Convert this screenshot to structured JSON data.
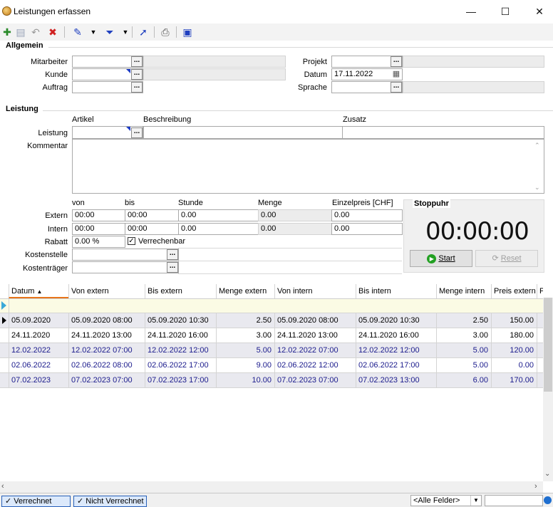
{
  "window": {
    "title": "Leistungen erfassen",
    "minimize": "—",
    "maximize": "☐",
    "close": "✕"
  },
  "toolbar": {
    "items": [
      "new-icon",
      "save-icon",
      "undo-icon",
      "delete-icon",
      "pin-icon",
      "filter-icon",
      "pointer-icon",
      "print-icon",
      "calculator-icon"
    ],
    "accent": "#1f3fbf"
  },
  "allgemein": {
    "title": "Allgemein",
    "mitarbeiter_label": "Mitarbeiter",
    "mitarbeiter_value": "",
    "kunde_label": "Kunde",
    "kunde_value": "",
    "auftrag_label": "Auftrag",
    "auftrag_value": "",
    "projekt_label": "Projekt",
    "projekt_value": "",
    "datum_label": "Datum",
    "datum_value": "17.11.2022",
    "sprache_label": "Sprache",
    "sprache_value": "",
    "dots": "..."
  },
  "leistung": {
    "title": "Leistung",
    "artikel_header": "Artikel",
    "beschreibung_header": "Beschreibung",
    "zusatz_header": "Zusatz",
    "leistung_label": "Leistung",
    "kommentar_label": "Kommentar",
    "von": "von",
    "bis": "bis",
    "stunde": "Stunde",
    "menge": "Menge",
    "einzelpreis": "Einzelpreis [CHF]",
    "extern_label": "Extern",
    "intern_label": "Intern",
    "rabatt_label": "Rabatt",
    "extern": {
      "von": "00:00",
      "bis": "00:00",
      "stunde": "0.00",
      "menge": "0.00",
      "preis": "0.00"
    },
    "intern": {
      "von": "00:00",
      "bis": "00:00",
      "stunde": "0.00",
      "menge": "0.00",
      "preis": "0.00"
    },
    "rabatt_value": "0.00 %",
    "verrechenbar_label": "Verrechenbar",
    "kostenstelle_label": "Kostenstelle",
    "kostentraeger_label": "Kostenträger"
  },
  "stoppuhr": {
    "title": "Stoppuhr",
    "time": "00:00:00",
    "start": "Start",
    "reset": "Reset"
  },
  "grid": {
    "columns": [
      "Datum",
      "Von extern",
      "Bis extern",
      "Menge extern",
      "Von intern",
      "Bis intern",
      "Menge intern",
      "Preis extern",
      "P"
    ],
    "sort_indicator": "▲",
    "rows": [
      [
        "05.09.2020",
        "05.09.2020  08:00",
        "05.09.2020  10:30",
        "2.50",
        "05.09.2020  08:00",
        "05.09.2020  10:30",
        "2.50",
        "150.00"
      ],
      [
        "24.11.2020",
        "24.11.2020  13:00",
        "24.11.2020  16:00",
        "3.00",
        "24.11.2020  13:00",
        "24.11.2020  16:00",
        "3.00",
        "180.00"
      ],
      [
        "12.02.2022",
        "12.02.2022  07:00",
        "12.02.2022  12:00",
        "5.00",
        "12.02.2022  07:00",
        "12.02.2022  12:00",
        "5.00",
        "120.00"
      ],
      [
        "02.06.2022",
        "02.06.2022  08:00",
        "02.06.2022  17:00",
        "9.00",
        "02.06.2022  12:00",
        "02.06.2022  17:00",
        "5.00",
        "0.00"
      ],
      [
        "07.02.2023",
        "07.02.2023  07:00",
        "07.02.2023  17:00",
        "10.00",
        "07.02.2023  07:00",
        "07.02.2023  13:00",
        "6.00",
        "170.00"
      ]
    ],
    "row_colors": [
      "#000000",
      "#000000",
      "#1a1a8c",
      "#1a1a8c",
      "#1a1a8c"
    ]
  },
  "statusbar": {
    "verrechnet": "Verrechnet",
    "nicht_verrechnet": "Nicht Verrechnet",
    "alle_felder": "<Alle Felder>"
  }
}
